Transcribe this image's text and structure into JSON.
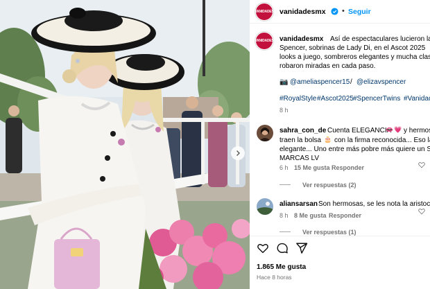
{
  "post": {
    "username": "vanidadesmx",
    "avatar_text": "VANIDADES",
    "follow_label": "Seguir",
    "brand_color": "#c3113d"
  },
  "caption": {
    "username": "vanidadesmx",
    "lines": [
      "Así de espectaculares lucieron las",
      "Spencer, sobrinas de Lady Di, en el Ascot 2025",
      "looks a juego, sombreros elegantes y mucha clase",
      "robaron miradas en cada paso."
    ],
    "mention_1": "@ameliaspencer15",
    "mention_sep": "/",
    "mention_2": "@elizavspencer",
    "hashtags": [
      "#RoyalStyle",
      "#Ascot2025",
      "#SpencerTwins",
      "#Vanidade"
    ],
    "time": "8 h"
  },
  "comments": [
    {
      "username": "sahra_con_de",
      "lines": [
        "Cuenta ELEGANCIA",
        "y hermos",
        "traen la bolsa",
        "con la firma reconocida... Eso las",
        "elegante... Uno entre más pobre más quiere un SE",
        "MARCAS LV"
      ],
      "time": "6 h",
      "likes": "15 Me gusta",
      "reply_label": "Responder",
      "view_replies": "Ver respuestas (2)"
    },
    {
      "username": "aliansarsan",
      "text": "Son hermosas, se les nota la aristocrac",
      "time": "8 h",
      "likes": "8 Me gusta",
      "reply_label": "Responder",
      "view_replies": "Ver respuestas (1)"
    }
  ],
  "footer": {
    "likes": "1.865 Me gusta",
    "time": "Hace 8 horas"
  }
}
